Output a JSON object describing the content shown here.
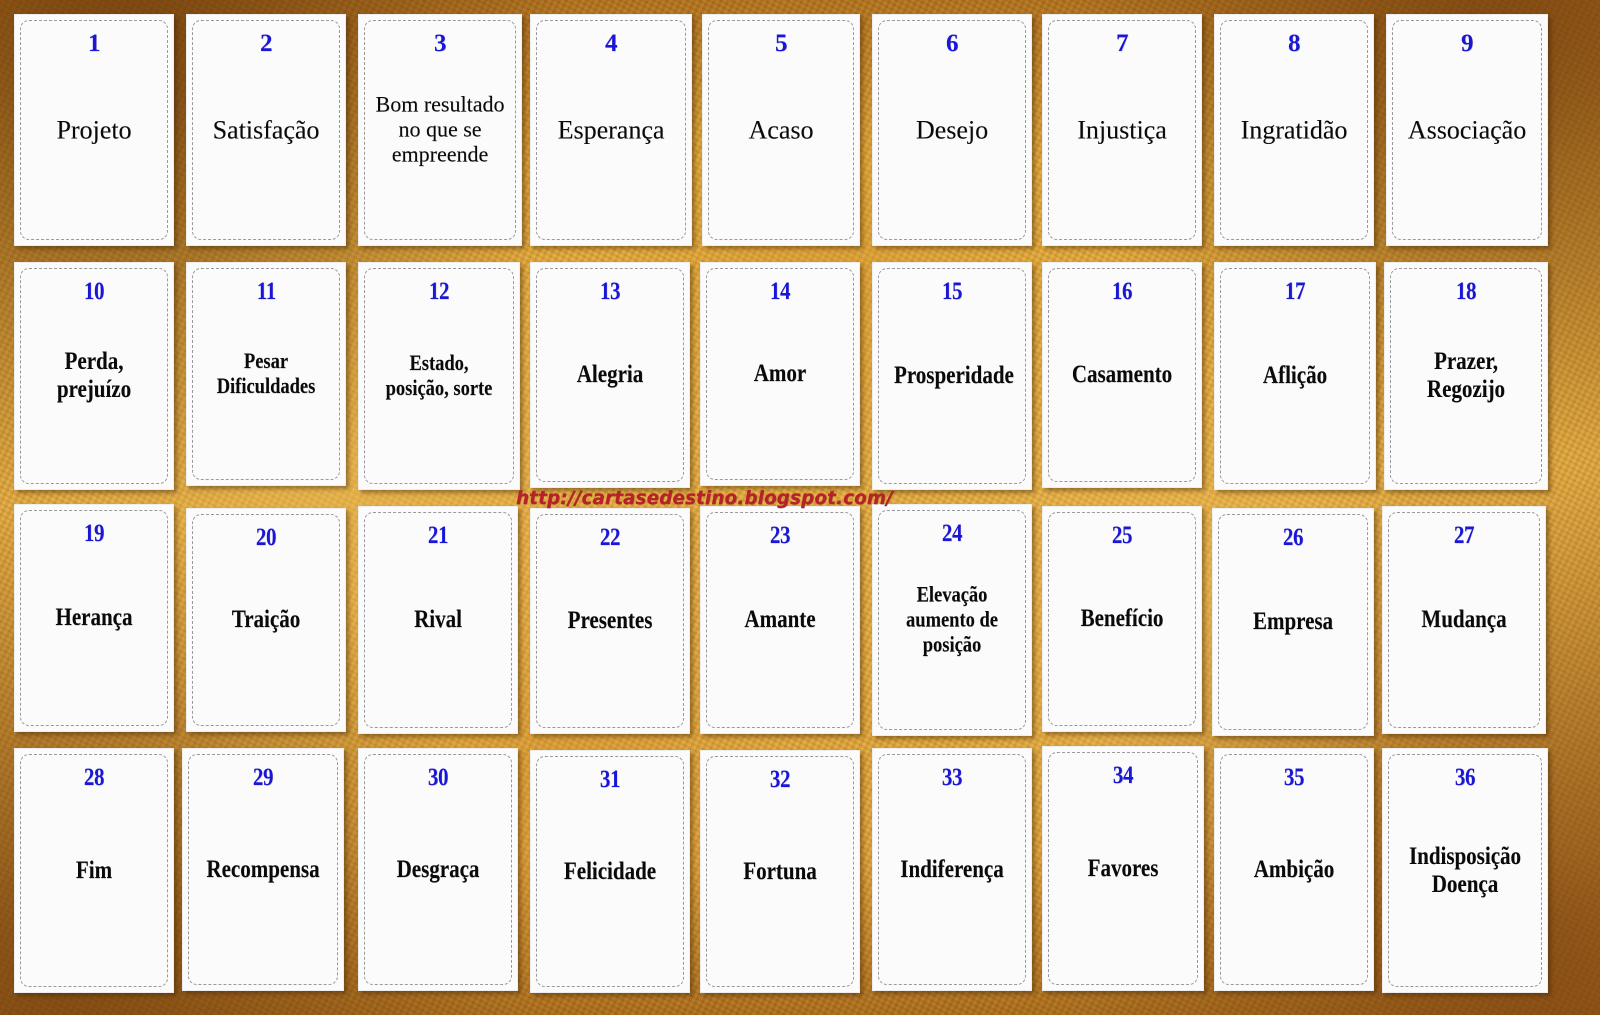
{
  "watermark": {
    "url": "http://cartasedestino.blogspot.com/",
    "color": "#b8202a"
  },
  "theme": {
    "background_color": "#e0a838",
    "card_color": "#fbfbfb",
    "number_color": "#1a16d8",
    "label_color": "#0a0a0a"
  },
  "grid": {
    "rows": 4,
    "columns": 9,
    "total_cards": 36
  },
  "cards": [
    {
      "number": "1",
      "label": "Projeto"
    },
    {
      "number": "2",
      "label": "Satisfação"
    },
    {
      "number": "3",
      "label": "Bom resultado no que se empreende"
    },
    {
      "number": "4",
      "label": "Esperança"
    },
    {
      "number": "5",
      "label": "Acaso"
    },
    {
      "number": "6",
      "label": "Desejo"
    },
    {
      "number": "7",
      "label": "Injustiça"
    },
    {
      "number": "8",
      "label": "Ingratidão"
    },
    {
      "number": "9",
      "label": "Associação"
    },
    {
      "number": "10",
      "label": "Perda, prejuízo"
    },
    {
      "number": "11",
      "label": "Pesar Dificuldades"
    },
    {
      "number": "12",
      "label": "Estado, posição, sorte"
    },
    {
      "number": "13",
      "label": "Alegria"
    },
    {
      "number": "14",
      "label": "Amor"
    },
    {
      "number": "15",
      "label": "Prosperidade"
    },
    {
      "number": "16",
      "label": "Casamento"
    },
    {
      "number": "17",
      "label": "Aflição"
    },
    {
      "number": "18",
      "label": "Prazer, Regozijo"
    },
    {
      "number": "19",
      "label": "Herança"
    },
    {
      "number": "20",
      "label": "Traição"
    },
    {
      "number": "21",
      "label": "Rival"
    },
    {
      "number": "22",
      "label": "Presentes"
    },
    {
      "number": "23",
      "label": "Amante"
    },
    {
      "number": "24",
      "label": "Elevação aumento de posição"
    },
    {
      "number": "25",
      "label": "Benefício"
    },
    {
      "number": "26",
      "label": "Empresa"
    },
    {
      "number": "27",
      "label": "Mudança"
    },
    {
      "number": "28",
      "label": "Fim"
    },
    {
      "number": "29",
      "label": "Recompensa"
    },
    {
      "number": "30",
      "label": "Desgraça"
    },
    {
      "number": "31",
      "label": "Felicidade"
    },
    {
      "number": "32",
      "label": "Fortuna"
    },
    {
      "number": "33",
      "label": "Indiferença"
    },
    {
      "number": "34",
      "label": "Favores"
    },
    {
      "number": "35",
      "label": "Ambição"
    },
    {
      "number": "36",
      "label": "Indisposição Doença"
    }
  ]
}
